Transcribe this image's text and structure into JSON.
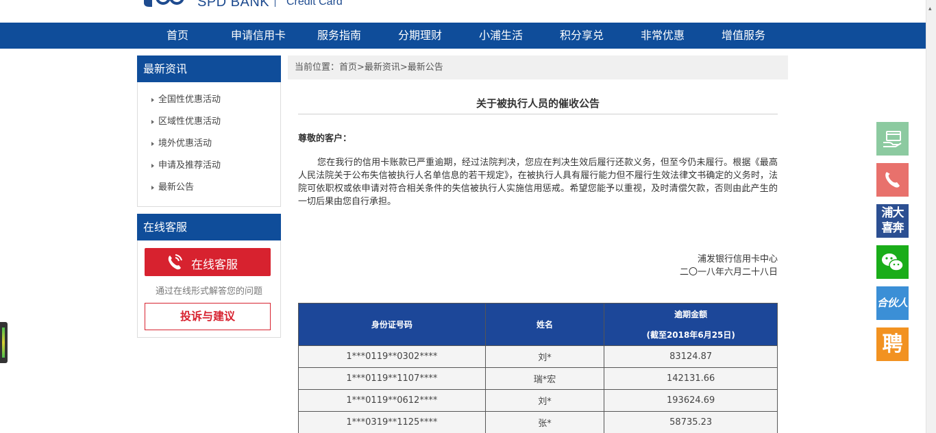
{
  "header": {
    "logo_text": "SPD BANK",
    "logo_sub": "Credit Card"
  },
  "nav": {
    "items": [
      "首页",
      "申请信用卡",
      "服务指南",
      "分期理财",
      "小浦生活",
      "积分享兑",
      "非常优惠",
      "增值服务"
    ]
  },
  "sidebar": {
    "news_title": "最新资讯",
    "news_items": [
      "全国性优惠活动",
      "区域性优惠活动",
      "境外优惠活动",
      "申请及推荐活动",
      "最新公告"
    ],
    "cs_title": "在线客服",
    "cs_button": "在线客服",
    "cs_desc": "通过在线形式解答您的问题",
    "complaint_button": "投诉与建议"
  },
  "breadcrumb": "当前位置：首页>最新资讯>最新公告",
  "article": {
    "title": "关于被执行人员的催收公告",
    "greeting": "尊敬的客户：",
    "body": "您在我行的信用卡账款已严重逾期，经过法院判决，您应在判决生效后履行还款义务，但至今仍未履行。根据《最高人民法院关于公布失信被执行人名单信息的若干规定》，在被执行人具有履行能力但不履行生效法律文书确定的义务时，法院可依职权或依申请对符合相关条件的失信被执行人实施信用惩戒。希望您能予以重视，及时清偿欠款，否则由此产生的一切后果由您自行承担。",
    "sign_org": "浦发银行信用卡中心",
    "sign_date": "二〇一八年六月二十八日"
  },
  "table": {
    "headers": {
      "id": "身份证号码",
      "name": "姓名",
      "amount_l1": "逾期金额",
      "amount_l2": "(截至2018年6月25日)"
    },
    "rows": [
      {
        "id": "1***0119**0302****",
        "name": "刘*",
        "amount": "83124.87"
      },
      {
        "id": "1***0119**1107****",
        "name": "瑞*宏",
        "amount": "142131.66"
      },
      {
        "id": "1***0119**0612****",
        "name": "刘*",
        "amount": "193624.69"
      },
      {
        "id": "1***0319**1125****",
        "name": "张*",
        "amount": "58735.23"
      }
    ]
  },
  "floating": {
    "icons": [
      "card-hand-icon",
      "phone-icon",
      "pufa-dakaixin-icon",
      "wechat-icon",
      "partner-icon",
      "recruit-icon"
    ],
    "f3_text": "浦大喜奔",
    "f5_text": "合伙人",
    "f6_text": "聘"
  },
  "colors": {
    "brand_blue": "#0f4d9a",
    "table_header_blue": "#1c4799",
    "accent_red": "#d7222f"
  }
}
